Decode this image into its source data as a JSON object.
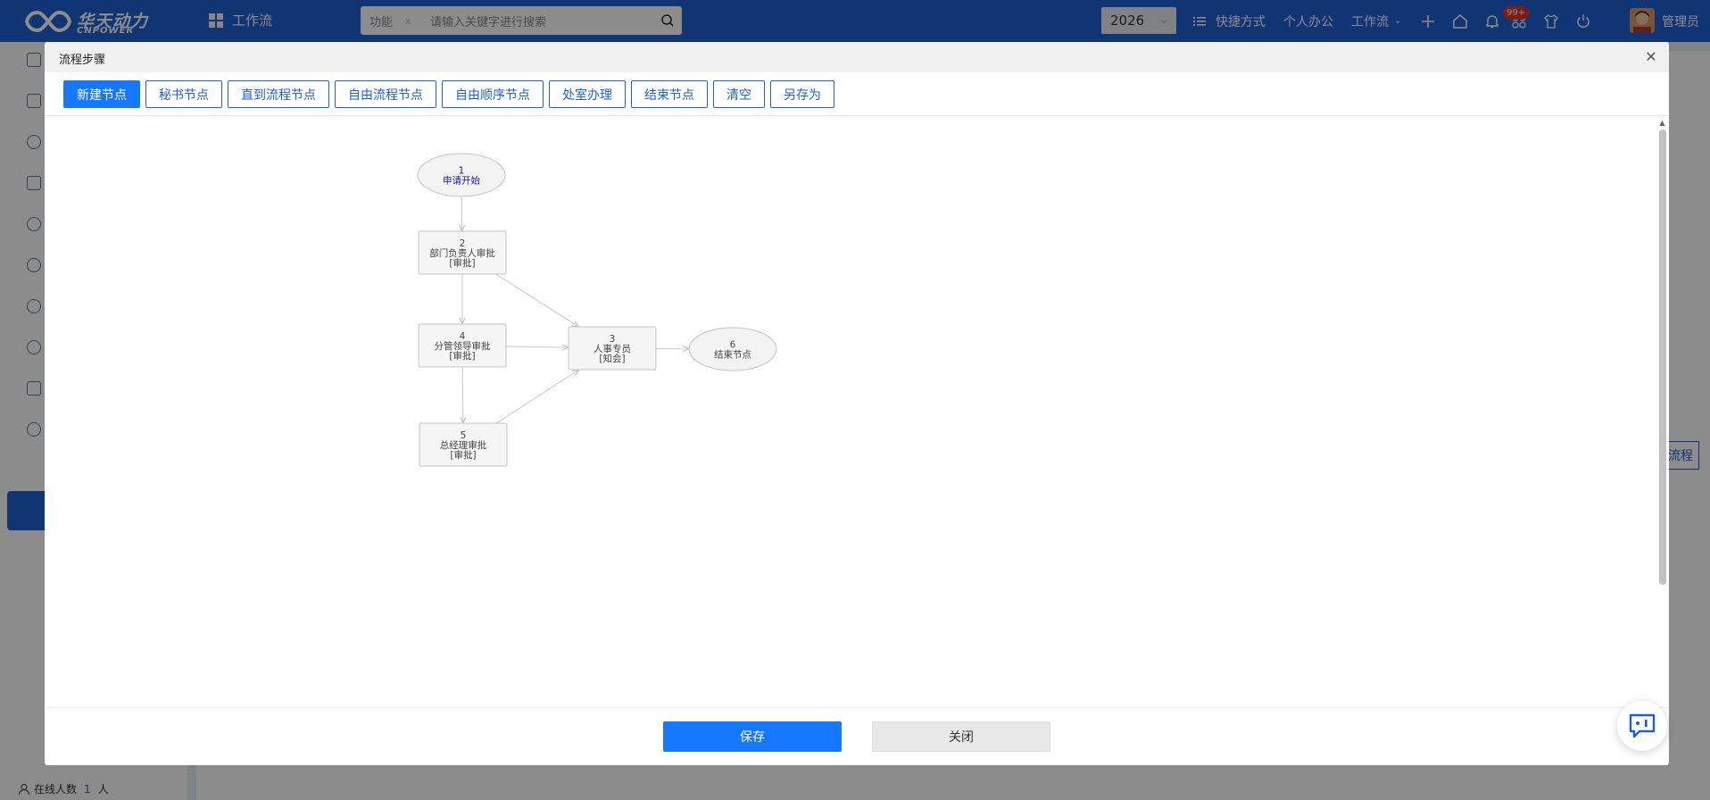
{
  "app": {
    "logo_cn": "华天动力",
    "logo_en": "CNPOWER",
    "nav_label": "工作流",
    "search": {
      "scope": "功能",
      "scope_clear": "x",
      "placeholder": "请输入关键字进行搜索"
    },
    "year": "2026",
    "shortcuts": "快捷方式",
    "personal_office": "个人办公",
    "workflow_menu": "工作流",
    "notification_badge": "99+",
    "user_name": "管理员",
    "accent_color": "#1f5fd6"
  },
  "sidebar": {
    "online_label": "在线人数",
    "online_count": "1",
    "online_unit": "人"
  },
  "background": {
    "button_label": "流程"
  },
  "dialog": {
    "title": "流程步骤",
    "toolbar": [
      {
        "label": "新建节点",
        "primary": true
      },
      {
        "label": "秘书节点"
      },
      {
        "label": "直到流程节点"
      },
      {
        "label": "自由流程节点"
      },
      {
        "label": "自由顺序节点"
      },
      {
        "label": "处室办理"
      },
      {
        "label": "结束节点"
      },
      {
        "label": "清空"
      },
      {
        "label": "另存为"
      }
    ],
    "save_label": "保存",
    "close_label": "关闭"
  },
  "flow": {
    "nodes": [
      {
        "id": "1",
        "name": "申请开始",
        "type": "",
        "shape": "start"
      },
      {
        "id": "2",
        "name": "部门负责人审批",
        "type": "[审批]",
        "shape": "task"
      },
      {
        "id": "4",
        "name": "分管领导审批",
        "type": "[审批]",
        "shape": "task"
      },
      {
        "id": "5",
        "name": "总经理审批",
        "type": "[审批]",
        "shape": "task"
      },
      {
        "id": "3",
        "name": "人事专员",
        "type": "[知会]",
        "shape": "task"
      },
      {
        "id": "6",
        "name": "结束节点",
        "type": "",
        "shape": "end"
      }
    ],
    "edges": [
      [
        "1",
        "2"
      ],
      [
        "2",
        "4"
      ],
      [
        "4",
        "5"
      ],
      [
        "2",
        "3"
      ],
      [
        "4",
        "3"
      ],
      [
        "5",
        "3"
      ],
      [
        "3",
        "6"
      ]
    ]
  }
}
